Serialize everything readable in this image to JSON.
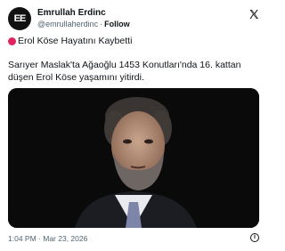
{
  "author": {
    "display_name": "Emrullah Erdinc",
    "handle": "@emrullaherdinc",
    "separator": "·",
    "follow_label": "Follow",
    "avatar_text": "EE"
  },
  "icons": {
    "logo": "x-logo-icon",
    "headline_marker": "red-circle-icon",
    "info": "info-icon"
  },
  "tweet": {
    "headline": "Erol Köse Hayatını Kaybetti",
    "body": "Sarıyer Maslak'ta Ağaoğlu 1453 Konutları'nda 16. kattan düşen Erol Köse yaşamını yitirdi."
  },
  "footer": {
    "time": "1:04 PM",
    "separator": "·",
    "date": "Mar 23, 2026",
    "info_glyph": "i"
  },
  "colors": {
    "text": "#0f1419",
    "secondary": "#536471",
    "red_marker": "#e0245e",
    "media_bg": "#0a0a0a"
  }
}
